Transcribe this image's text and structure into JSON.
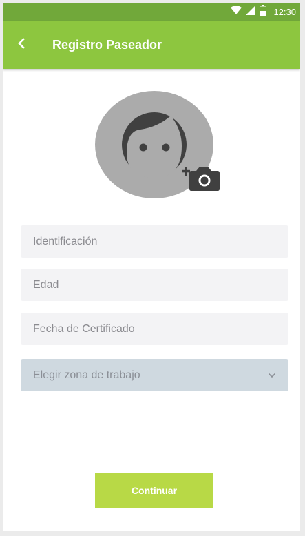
{
  "status_bar": {
    "time": "12:30",
    "icons": [
      "wifi-icon",
      "signal-icon",
      "battery-icon"
    ],
    "color": "#71a83a"
  },
  "app_bar": {
    "title": "Registro Paseador",
    "back_icon": "chevron-left-icon",
    "color": "#8dc63f"
  },
  "avatar": {
    "icon": "face-icon",
    "camera_icon": "add-photo-camera-icon",
    "background": "#ababab"
  },
  "form": {
    "identification_placeholder": "Identificación",
    "age_placeholder": "Edad",
    "certificate_date_placeholder": "Fecha de Certificado",
    "work_zone_select": {
      "selected_label": "Elegir zona de trabajo",
      "icon": "chevron-down-icon"
    }
  },
  "continue_button": {
    "label": "Continuar",
    "color": "#b8d946"
  }
}
